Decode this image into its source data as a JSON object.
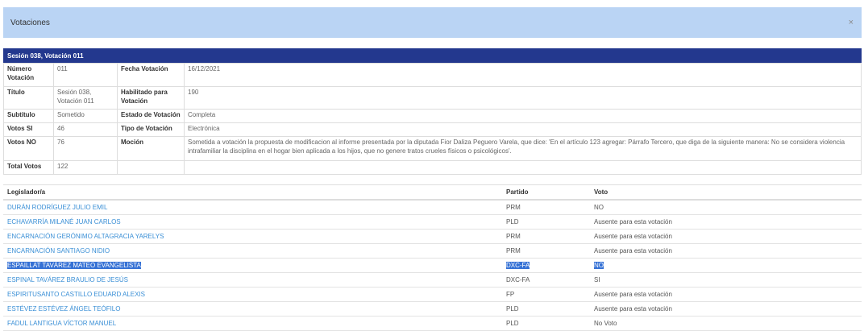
{
  "modal": {
    "title": "Votaciones",
    "close_glyph": "×",
    "close_icon": "close-icon"
  },
  "session_header": "Sesión 038, Votación 011",
  "details": {
    "numero_label": "Número Votación",
    "numero_value": "011",
    "fecha_label": "Fecha Votación",
    "fecha_value": "16/12/2021",
    "titulo_label": "Título",
    "titulo_value": "Sesión 038, Votación 011",
    "habilitado_label": "Habilitado para Votación",
    "habilitado_value": "190",
    "subtitulo_label": "Subtítulo",
    "subtitulo_value": "Sometido",
    "estado_label": "Estado de Votación",
    "estado_value": "Completa",
    "votos_si_label": "Votos SI",
    "votos_si_value": "46",
    "tipo_label": "Tipo de Votación",
    "tipo_value": "Electrónica",
    "votos_no_label": "Votos NO",
    "votos_no_value": "76",
    "mocion_label": "Moción",
    "mocion_value": "Sometida a votación la propuesta de modificacion al informe presentada por la diputada Fior Daliza Peguero Varela, que dice: 'En el artículo 123 agregar: Párrafo Tercero, que diga de la siguiente manera: No se considera violencia intrafamiliar la disciplina en el hogar bien aplicada a los hijos, que no genere tratos crueles físicos o psicológicos'.",
    "total_label": "Total Votos",
    "total_value": "122"
  },
  "votes_table": {
    "headers": {
      "legislador": "Legislador/a",
      "partido": "Partido",
      "voto": "Voto"
    },
    "rows": [
      {
        "legislador": "DURÁN RODRÍGUEZ JULIO EMIL",
        "partido": "PRM",
        "voto": "NO"
      },
      {
        "legislador": "ECHAVARRÍA MILANÉ JUAN CARLOS",
        "partido": "PLD",
        "voto": "Ausente para esta votación"
      },
      {
        "legislador": "ENCARNACIÓN GERÓNIMO ALTAGRACIA YARELYS",
        "partido": "PRM",
        "voto": "Ausente para esta votación"
      },
      {
        "legislador": "ENCARNACIÓN SANTIAGO NIDIO",
        "partido": "PRM",
        "voto": "Ausente para esta votación"
      },
      {
        "legislador": "ESPAILLAT TAVÁREZ MATEO EVANGELISTA",
        "partido": "DXC-FA",
        "voto": "NO"
      },
      {
        "legislador": "ESPINAL TAVÁREZ BRAULIO DE JESÚS",
        "partido": "DXC-FA",
        "voto": "SI"
      },
      {
        "legislador": "ESPIRITUSANTO CASTILLO EDUARD ALEXIS",
        "partido": "FP",
        "voto": "Ausente para esta votación"
      },
      {
        "legislador": "ESTÉVEZ ESTÉVEZ ÁNGEL TEÓFILO",
        "partido": "PLD",
        "voto": "Ausente para esta votación"
      },
      {
        "legislador": "FADUL LANTIGUA VÍCTOR MANUEL",
        "partido": "PLD",
        "voto": "No Voto"
      }
    ]
  },
  "colors": {
    "header_bg": "#bad4f4",
    "session_bar": "#23388e",
    "link": "#3a8fd6",
    "selection": "#3571d5"
  }
}
